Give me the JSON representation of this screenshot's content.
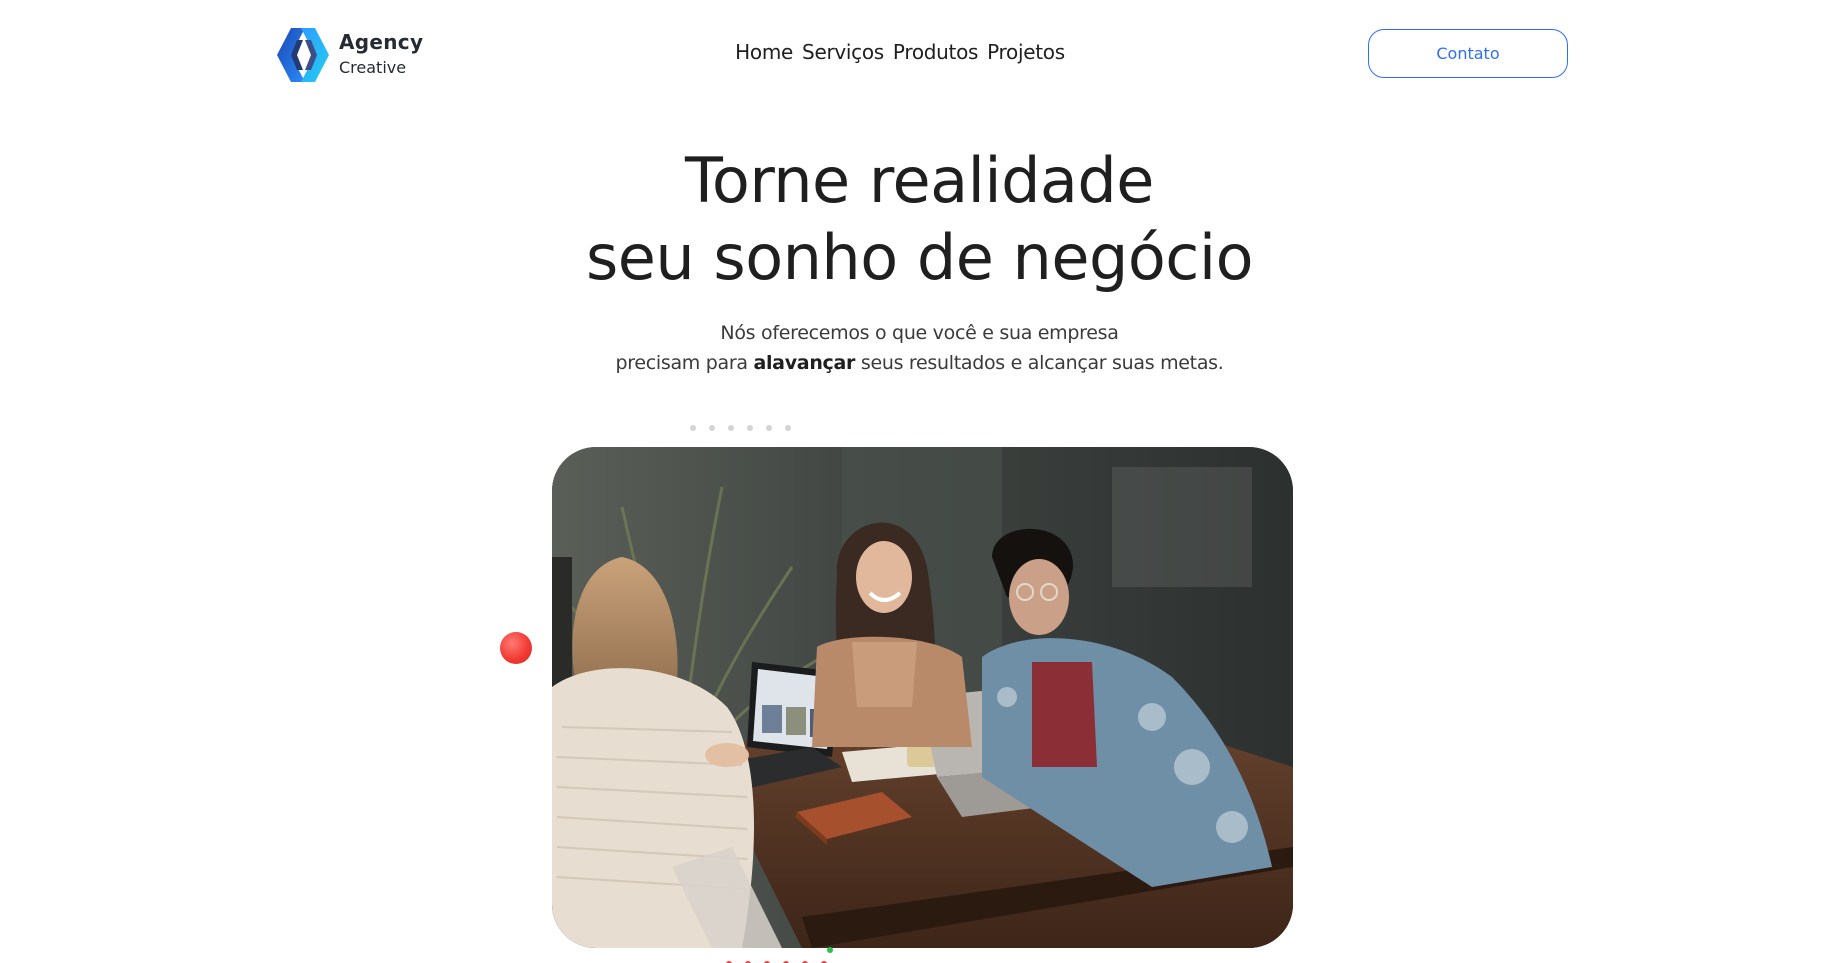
{
  "brand": {
    "name": "Agency",
    "tagline": "Creative",
    "logo_icon": "hexagon-chevrons-logo"
  },
  "nav": {
    "items": [
      "Home",
      "Serviços",
      "Produtos",
      "Projetos"
    ]
  },
  "contact_button": {
    "label": "Contato"
  },
  "hero": {
    "title_line1": "Torne realidade",
    "title_line2": "seu sonho de negócio",
    "subtitle_line1": "Nós oferecemos o que você e sua empresa",
    "subtitle_line2_before": "precisam para ",
    "subtitle_line2_bold": "alavançar",
    "subtitle_line2_after": " seus resultados e alcançar suas metas."
  },
  "colors": {
    "accent": "#2d6ff5",
    "text": "#1f1f1f",
    "decor_red": "#f23b35",
    "decor_green": "#29c04c",
    "decor_gray": "#d4d4d4"
  }
}
